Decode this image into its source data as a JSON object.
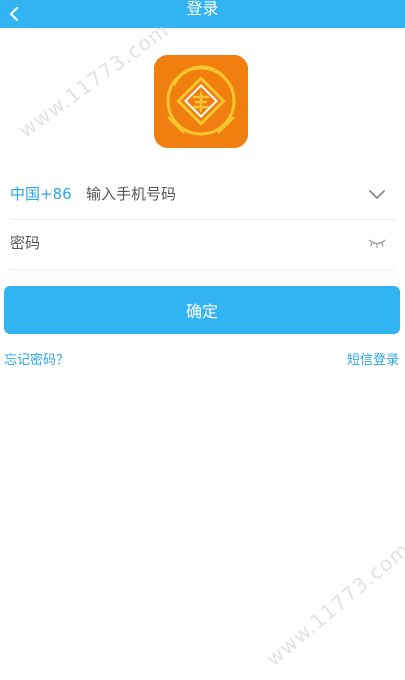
{
  "header": {
    "title": "登录"
  },
  "login_form": {
    "country_code": "中国+86",
    "phone_placeholder": "输入手机号码",
    "password_placeholder": "密码",
    "confirm_label": "确定"
  },
  "links": {
    "forgot_password": "忘记密码？",
    "sms_login": "短信登录"
  },
  "watermark": {
    "text": "www.11773.com"
  },
  "colors": {
    "accent": "#33b4f2",
    "link": "#2aa7e8",
    "logo_orange": "#f07f10",
    "logo_ring": "#f7c531"
  },
  "icons": {
    "back": "chevron-left-icon",
    "dropdown": "chevron-down-icon",
    "password_visibility": "eye-closed-icon",
    "logo": "app-logo-icon"
  }
}
